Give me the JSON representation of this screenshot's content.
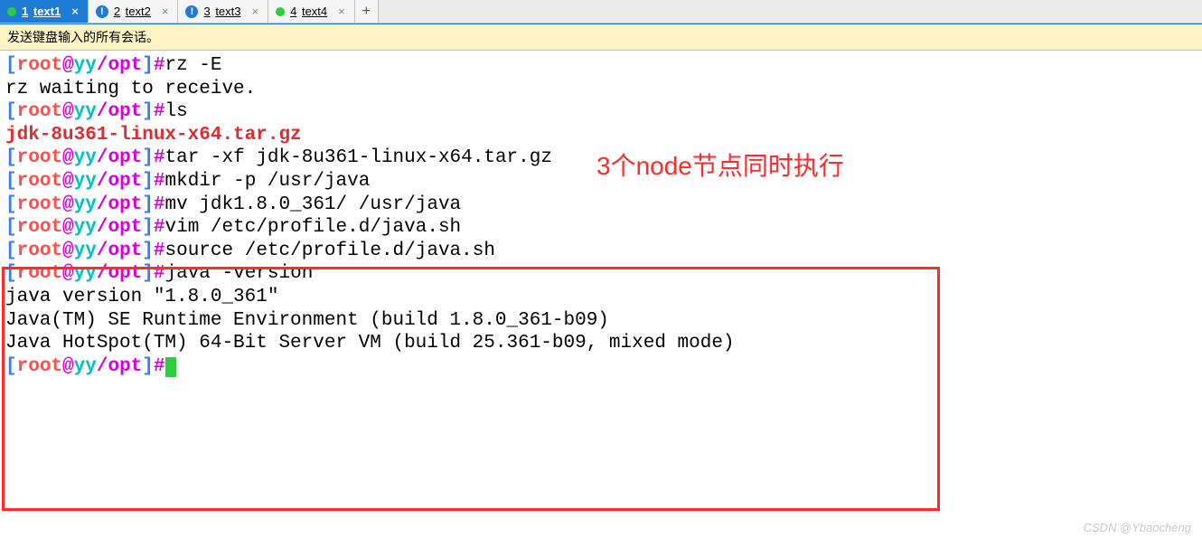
{
  "tabs": [
    {
      "num": "1",
      "label": "text1",
      "status": "dot-green",
      "active": true
    },
    {
      "num": "2",
      "label": "text2",
      "status": "alert",
      "active": false
    },
    {
      "num": "3",
      "label": "text3",
      "status": "alert",
      "active": false
    },
    {
      "num": "4",
      "label": "text4",
      "status": "dot-green",
      "active": false
    }
  ],
  "add_tab": "+",
  "close_glyph": "×",
  "info_bar": "发送键盘输入的所有会话。",
  "prompt": {
    "lb": "[",
    "user": "root",
    "at": "@",
    "host": "yy",
    "path": "/opt",
    "rb": "]",
    "hash": "#"
  },
  "lines": {
    "l1_cmd": "rz -E",
    "l2_out": "rz waiting to receive.",
    "l3_cmd": "ls",
    "l4_out": "jdk-8u361-linux-x64.tar.gz",
    "l5_cmd": "tar -xf jdk-8u361-linux-x64.tar.gz",
    "l6_cmd": "mkdir -p /usr/java",
    "l7_cmd": "mv jdk1.8.0_361/ /usr/java",
    "l8_cmd": "vim /etc/profile.d/java.sh",
    "l9_cmd": "source /etc/profile.d/java.sh",
    "l10_cmd": "java -version",
    "l11_out": "java version \"1.8.0_361\"",
    "l12_out": "Java(TM) SE Runtime Environment (build 1.8.0_361-b09)",
    "l13_out": "Java HotSpot(TM) 64-Bit Server VM (build 25.361-b09, mixed mode)"
  },
  "annotation": "3个node节点同时执行",
  "watermark": "CSDN @Ybaocheng"
}
